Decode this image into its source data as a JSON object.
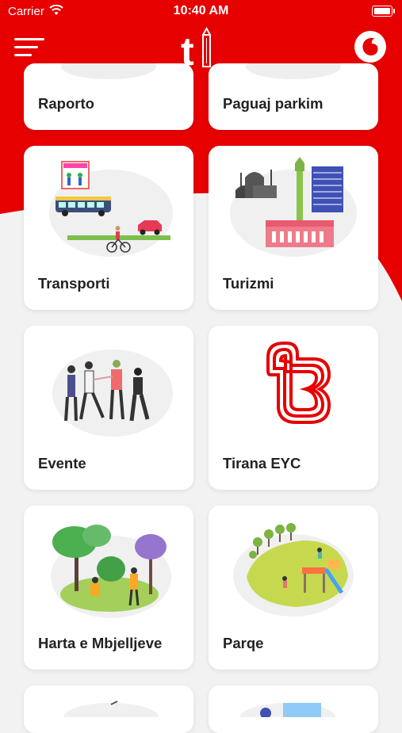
{
  "status_bar": {
    "carrier": "Carrier",
    "time": "10:40 AM"
  },
  "header": {
    "logo_icon": "tirana-t-tower-logo",
    "menu_icon": "hamburger-menu-icon",
    "brand_icon": "vodafone-logo-icon"
  },
  "colors": {
    "brand_red": "#e60000",
    "background": "#f2f2f2",
    "card": "#ffffff",
    "text": "#222222"
  },
  "tiles": [
    {
      "label": "Raporto",
      "icon": "report-illustration"
    },
    {
      "label": "Paguaj parkim",
      "icon": "parking-illustration"
    },
    {
      "label": "Transporti",
      "icon": "bus-bicycle-car-illustration"
    },
    {
      "label": "Turizmi",
      "icon": "city-landmarks-illustration"
    },
    {
      "label": "Evente",
      "icon": "people-event-illustration"
    },
    {
      "label": "Tirana EYC",
      "icon": "tirana-eyc-logo"
    },
    {
      "label": "Harta e Mbjelljeve",
      "icon": "tree-planting-illustration"
    },
    {
      "label": "Parqe",
      "icon": "park-playground-illustration"
    }
  ]
}
